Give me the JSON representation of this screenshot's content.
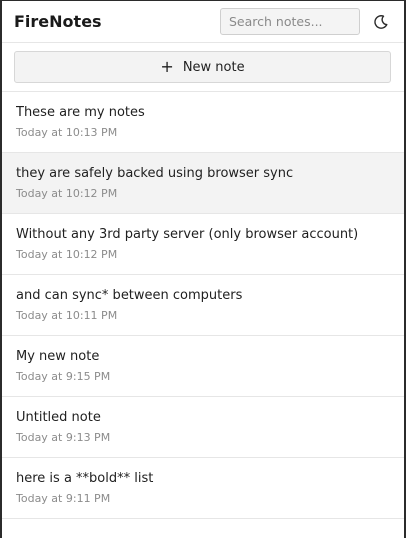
{
  "app": {
    "title": "FireNotes"
  },
  "search": {
    "placeholder": "Search notes..."
  },
  "toolbar": {
    "new_note_label": "New note",
    "plus_glyph": "+"
  },
  "theme": {
    "icon": "moon-icon"
  },
  "notes": [
    {
      "title": "These are my notes",
      "time": "Today at 10:13 PM",
      "selected": false
    },
    {
      "title": "they are safely backed using browser sync",
      "time": "Today at 10:12 PM",
      "selected": true
    },
    {
      "title": "Without any 3rd party server (only browser account)",
      "time": "Today at 10:12 PM",
      "selected": false
    },
    {
      "title": "and can sync* between computers",
      "time": "Today at 10:11 PM",
      "selected": false
    },
    {
      "title": "My new note",
      "time": "Today at 9:15 PM",
      "selected": false
    },
    {
      "title": "Untitled note",
      "time": "Today at 9:13 PM",
      "selected": false
    },
    {
      "title": "here is a **bold** list",
      "time": "Today at 9:11 PM",
      "selected": false
    }
  ],
  "colors": {
    "selected_bg": "#f3f3f3",
    "border": "#e6e6e6",
    "muted_text": "#8c8c8c"
  }
}
